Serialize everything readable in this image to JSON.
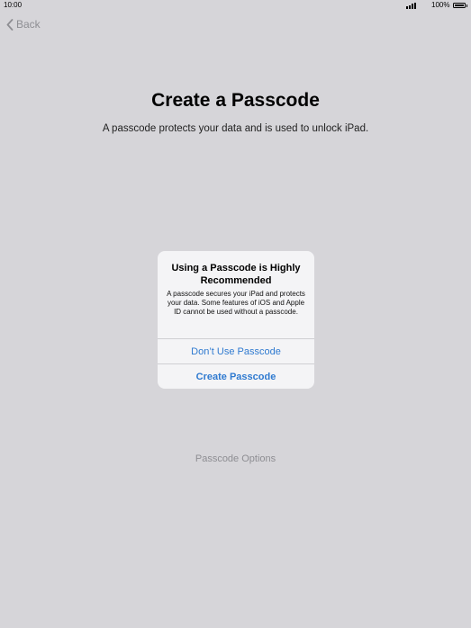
{
  "status_bar": {
    "time": "10:00",
    "battery": "100%"
  },
  "nav": {
    "back_label": "Back"
  },
  "main": {
    "title": "Create a Passcode",
    "subtitle": "A passcode protects your data and is used to unlock iPad.",
    "options_label": "Passcode Options"
  },
  "alert": {
    "title": "Using a Passcode is Highly Recommended",
    "message": "A passcode secures your iPad and protects your data. Some features of iOS and Apple ID cannot be used without a passcode.",
    "dont_use_label": "Don’t Use Passcode",
    "create_label": "Create Passcode"
  },
  "colors": {
    "background": "#d6d5d9",
    "accent": "#2f7ad0",
    "muted": "#8e8e93",
    "alert_background": "#f4f4f6"
  },
  "icons": {
    "back": "chevron-left-icon",
    "signal": "signal-icon",
    "battery": "battery-icon"
  }
}
